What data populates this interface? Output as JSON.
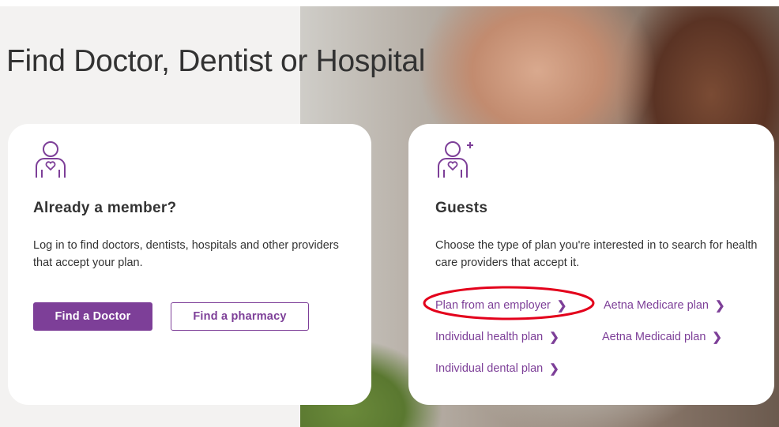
{
  "page": {
    "title": "Find Doctor, Dentist or Hospital"
  },
  "member_card": {
    "icon": "person-heart-icon",
    "heading": "Already a member?",
    "description": "Log in to find doctors, dentists, hospitals and other providers that accept your plan.",
    "primary_button": "Find a Doctor",
    "secondary_button": "Find a pharmacy"
  },
  "guest_card": {
    "icon": "person-heart-plus-icon",
    "heading": "Guests",
    "description": "Choose the type of plan you're interested in to search for health care providers that accept it.",
    "links": [
      {
        "label": "Plan from an employer"
      },
      {
        "label": "Aetna Medicare plan"
      },
      {
        "label": "Individual health plan"
      },
      {
        "label": "Aetna Medicaid plan"
      },
      {
        "label": "Individual dental plan"
      }
    ],
    "chevron": "❯"
  },
  "colors": {
    "brand_purple": "#7d3f98",
    "annotation_red": "#e3001b",
    "text": "#333333"
  }
}
